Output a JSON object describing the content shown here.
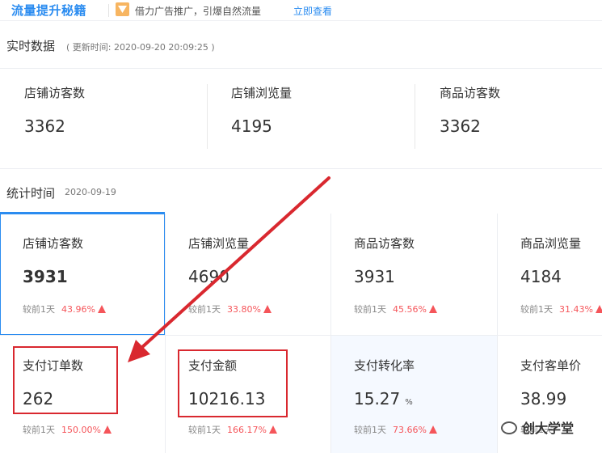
{
  "promo": {
    "brand": "流量提升秘籍",
    "text": "借力广告推广，引爆自然流量",
    "link": "立即查看"
  },
  "realtime": {
    "title": "实时数据",
    "updated": "( 更新时间: 2020-09-20 20:09:25 )",
    "cards": [
      {
        "label": "店铺访客数",
        "value": "3362"
      },
      {
        "label": "店铺浏览量",
        "value": "4195"
      },
      {
        "label": "商品访客数",
        "value": "3362"
      }
    ]
  },
  "stats": {
    "title": "统计时间",
    "date": "2020-09-19",
    "cells": [
      {
        "label": "店铺访客数",
        "value": "3931",
        "unit": "",
        "cmp": "较前1天",
        "pct": "43.96%"
      },
      {
        "label": "店铺浏览量",
        "value": "4690",
        "unit": "",
        "cmp": "较前1天",
        "pct": "33.80%"
      },
      {
        "label": "商品访客数",
        "value": "3931",
        "unit": "",
        "cmp": "较前1天",
        "pct": "45.56%"
      },
      {
        "label": "商品浏览量",
        "value": "4184",
        "unit": "",
        "cmp": "较前1天",
        "pct": "31.43%"
      },
      {
        "label": "支付订单数",
        "value": "262",
        "unit": "",
        "cmp": "较前1天",
        "pct": "150.00%"
      },
      {
        "label": "支付金额",
        "value": "10216.13",
        "unit": "",
        "cmp": "较前1天",
        "pct": "166.17%"
      },
      {
        "label": "支付转化率",
        "value": "15.27",
        "unit": "%",
        "cmp": "较前1天",
        "pct": "73.66%"
      },
      {
        "label": "支付客单价",
        "value": "38.99",
        "unit": "",
        "cmp": "较前1天",
        "pct": ""
      }
    ]
  },
  "watermark": "创大学堂",
  "colors": {
    "accent": "#2b8cf0",
    "up": "#f5555a",
    "annotation": "#d9282f",
    "highlight_bg": "#f5f9ff"
  },
  "icons": {
    "promo": "funnel-icon",
    "trend": "arrow-up-icon",
    "watermark": "wechat-icon"
  }
}
